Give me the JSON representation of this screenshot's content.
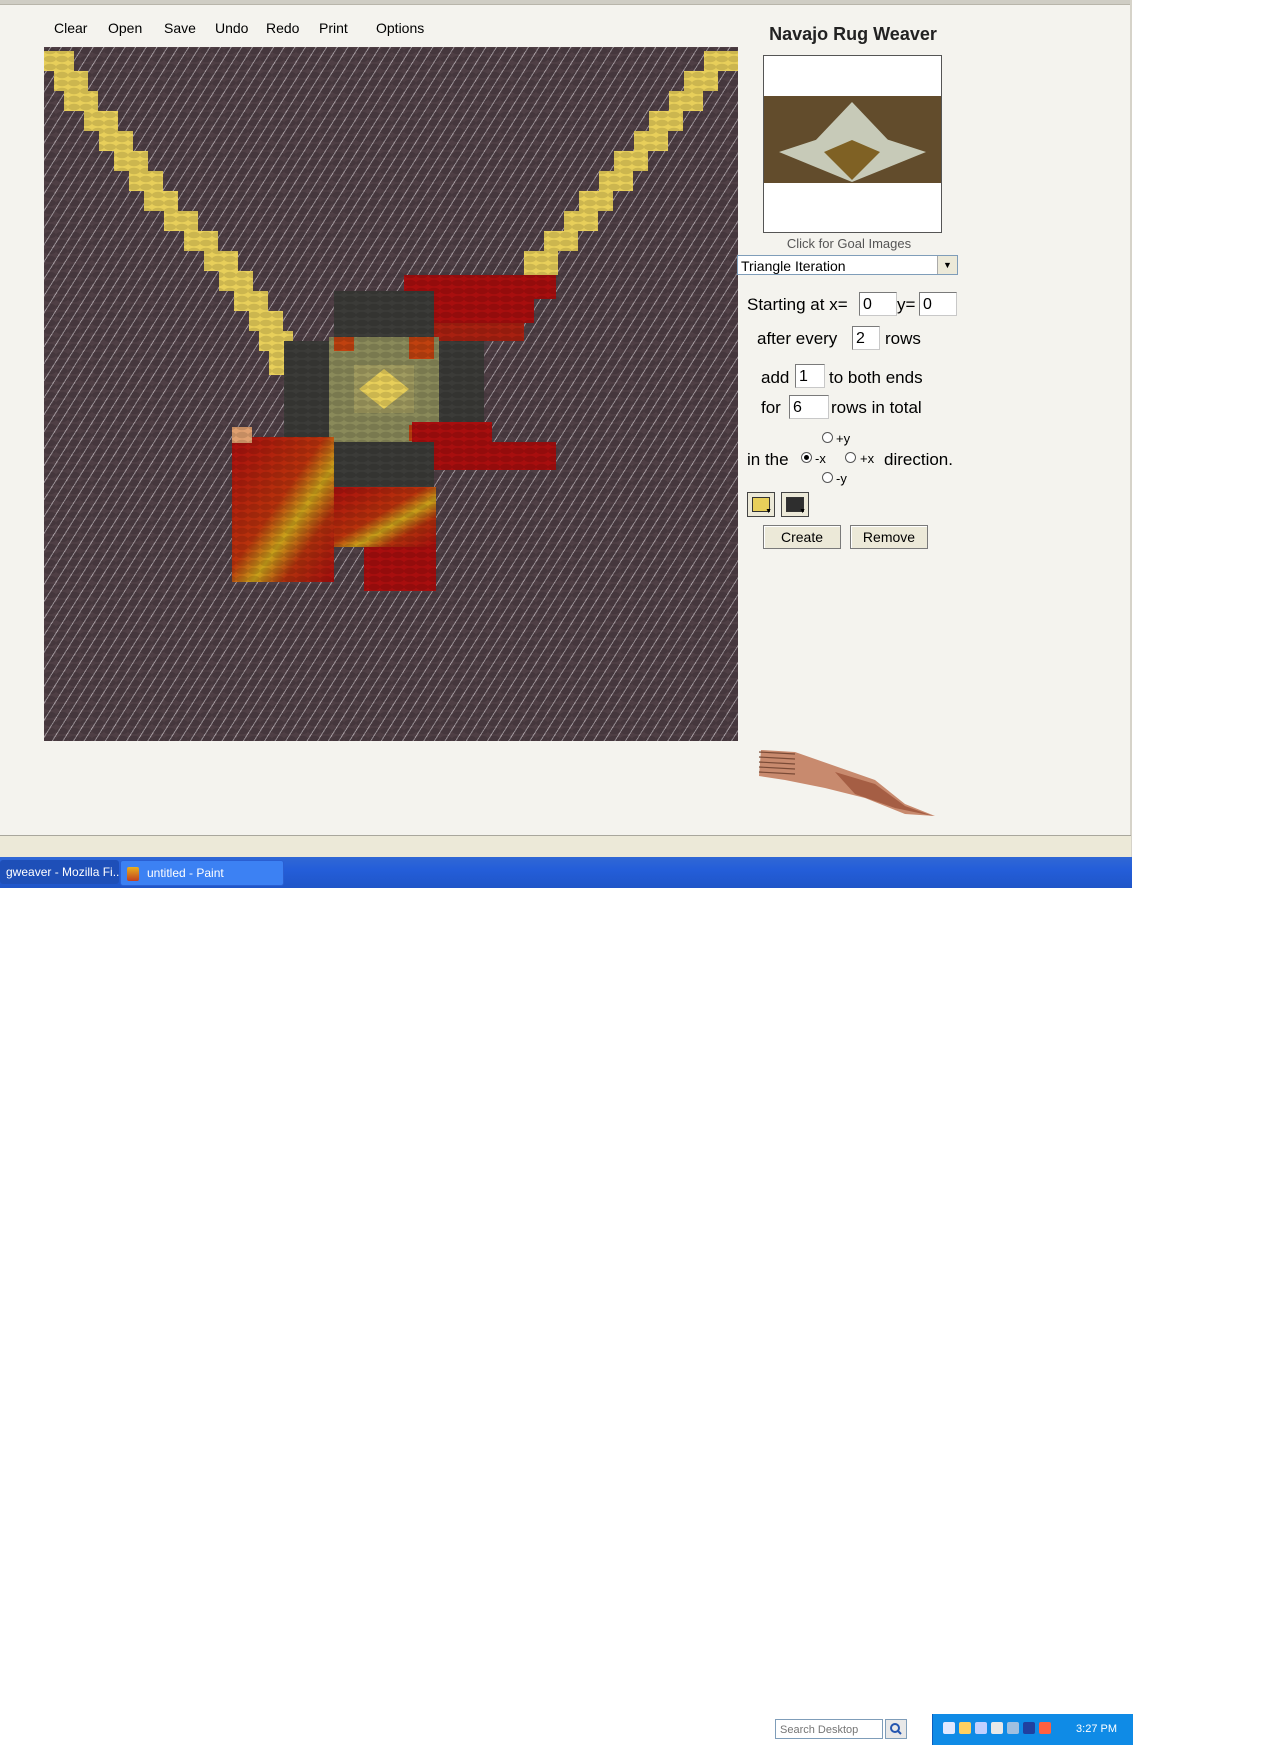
{
  "menu": [
    "Clear",
    "Open",
    "Save",
    "Undo",
    "Redo",
    "Print",
    "Options"
  ],
  "app_title": "Navajo Rug Weaver",
  "goal_caption": "Click for Goal Images",
  "tool_select": {
    "value": "Triangle Iteration"
  },
  "form": {
    "starting_label": "Starting at x=",
    "x_value": "0",
    "y_label": "y=",
    "y_value": "0",
    "after_every_label": "after every",
    "after_every_value": "2",
    "rows_label": "rows",
    "add_label": "add",
    "add_value": "1",
    "both_ends_label": "to both ends",
    "for_label": "for",
    "for_value": "6",
    "rows_total_label": "rows in total",
    "in_the_label": "in the",
    "direction_label": "direction."
  },
  "direction": {
    "options": [
      "+y",
      "-x",
      "+x",
      "-y"
    ],
    "selected": "-x"
  },
  "colors": {
    "primary": "#e8cf5a",
    "secondary": "#2e2e2e",
    "background_yarn": "#4f3f45",
    "red": "#a80e0e",
    "orange": "#c0410f",
    "olive": "#8a8a5a",
    "dark": "#3b3b38"
  },
  "buttons": {
    "create": "Create",
    "remove": "Remove"
  },
  "taskbar": {
    "firefox_task": "gweaver - Mozilla Fi...",
    "paint_task": "untitled - Paint",
    "search_placeholder": "Search Desktop",
    "clock": "3:27 PM"
  }
}
